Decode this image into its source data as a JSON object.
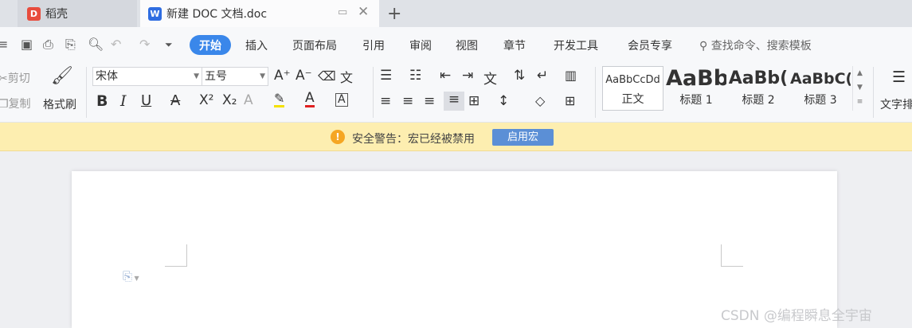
{
  "tabs": [
    {
      "label": "稻壳",
      "icon": "docer-icon",
      "color": "#e84c3d"
    },
    {
      "label": "新建 DOC 文档.doc",
      "icon": "word-doc-icon",
      "color": "#2f6de1"
    }
  ],
  "menu": {
    "items": [
      "开始",
      "插入",
      "页面布局",
      "引用",
      "审阅",
      "视图",
      "章节",
      "开发工具",
      "会员专享"
    ],
    "search_placeholder": "查找命令、搜索模板"
  },
  "clipboard": {
    "cut": "剪切",
    "copy": "复制",
    "format_painter": "格式刷"
  },
  "font": {
    "name": "宋体",
    "size": "五号"
  },
  "styles": [
    {
      "preview": "AaBbCcDd",
      "label": "正文"
    },
    {
      "preview": "AaBb",
      "label": "标题 1"
    },
    {
      "preview": "AaBb(",
      "label": "标题 2"
    },
    {
      "preview": "AaBbC(",
      "label": "标题 3"
    }
  ],
  "text_layout": "文字排",
  "warning": {
    "text": "安全警告：宏已经被禁用",
    "button": "启用宏"
  },
  "watermark": "CSDN @编程瞬息全宇宙",
  "colors": {
    "accent": "#3a87ea",
    "warning_bg": "#fdeeb0",
    "highlight": "#f4e100",
    "font_color": "#e02020"
  }
}
